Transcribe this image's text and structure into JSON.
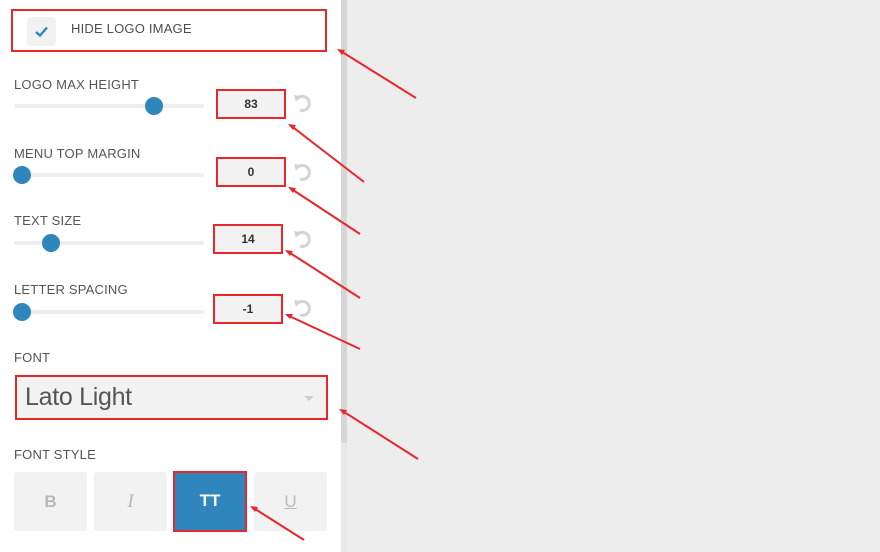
{
  "hide_logo": {
    "label": "HIDE LOGO IMAGE",
    "checked": true
  },
  "settings": [
    {
      "label": "LOGO MAX HEIGHT",
      "value": "83"
    },
    {
      "label": "MENU TOP MARGIN",
      "value": "0"
    },
    {
      "label": "TEXT SIZE",
      "value": "14"
    },
    {
      "label": "LETTER SPACING",
      "value": "-1"
    }
  ],
  "font": {
    "label": "FONT",
    "value": "Lato Light"
  },
  "font_style": {
    "label": "FONT STYLE",
    "buttons": [
      {
        "label": "B",
        "name": "bold",
        "active": false
      },
      {
        "label": "I",
        "name": "italic",
        "active": false
      },
      {
        "label": "TT",
        "name": "uppercase",
        "active": true
      },
      {
        "label": "U",
        "name": "underline",
        "active": false
      }
    ]
  },
  "colors": {
    "accent": "#2e86bd",
    "annotation": "#e8262b"
  }
}
